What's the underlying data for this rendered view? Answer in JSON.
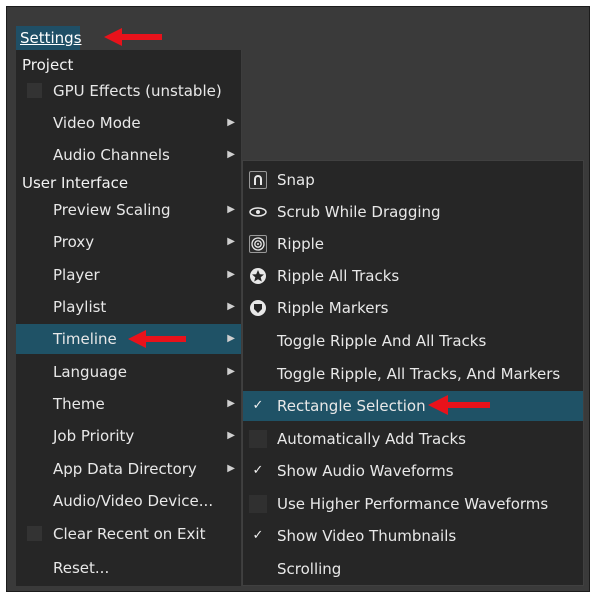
{
  "menubar": {
    "settings_label": "Settings"
  },
  "settings_menu": {
    "section_project": "Project",
    "gpu_effects": "GPU Effects (unstable)",
    "video_mode": "Video Mode",
    "audio_channels": "Audio Channels",
    "section_user_interface": "User Interface",
    "preview_scaling": "Preview Scaling",
    "proxy": "Proxy",
    "player": "Player",
    "playlist": "Playlist",
    "timeline": "Timeline",
    "language": "Language",
    "theme": "Theme",
    "job_priority": "Job Priority",
    "app_data_directory": "App Data Directory",
    "audio_video_device": "Audio/Video Device...",
    "clear_recent_on_exit": "Clear Recent on Exit",
    "reset": "Reset..."
  },
  "timeline_submenu": {
    "snap": "Snap",
    "scrub_while_dragging": "Scrub While Dragging",
    "ripple": "Ripple",
    "ripple_all_tracks": "Ripple All Tracks",
    "ripple_markers": "Ripple Markers",
    "toggle_ripple_all_tracks": "Toggle Ripple And All Tracks",
    "toggle_ripple_tracks_markers": "Toggle Ripple, All Tracks, And Markers",
    "rectangle_selection": "Rectangle Selection",
    "auto_add_tracks": "Automatically Add Tracks",
    "show_audio_waveforms": "Show Audio Waveforms",
    "higher_perf_waveforms": "Use Higher Performance Waveforms",
    "show_video_thumbnails": "Show Video Thumbnails",
    "scrolling": "Scrolling"
  },
  "checkmark": "✓",
  "colors": {
    "highlight": "#1f5266",
    "menu_bg": "#262626",
    "annotation_red": "#e8121b"
  },
  "icons": [
    "snap-magnet-icon",
    "scrub-icon",
    "ripple-icon",
    "ripple-all-tracks-icon",
    "ripple-markers-icon",
    "submenu-arrow-icon",
    "annotation-arrow-icon"
  ]
}
